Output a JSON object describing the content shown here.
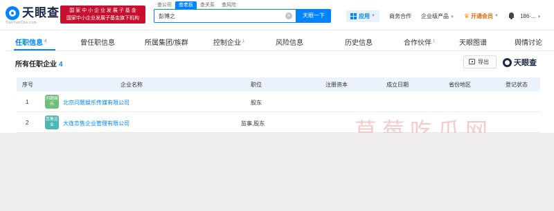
{
  "header": {
    "logo_text": "天眼查",
    "logo_sub": "TianYanCha.com",
    "banner_line1": "国 家 中 小 企 业 发 展 子 基 金",
    "banner_line2": "国家中小企业发展子基金旗下机构",
    "search_tabs": [
      "查公司",
      "查老板",
      "查关系",
      "查风险"
    ],
    "search_value": "彭博之",
    "search_button": "天眼一下",
    "app_label": "应用",
    "business": "商务合作",
    "enterprise": "企业级产品",
    "vip": "开通会员",
    "user": "186·..."
  },
  "tabs": [
    {
      "label": "任职信息",
      "count": "4"
    },
    {
      "label": "曾任职信息",
      "count": ""
    },
    {
      "label": "所属集团/族群",
      "count": ""
    },
    {
      "label": "控制企业",
      "count": "1"
    },
    {
      "label": "风险信息",
      "count": ""
    },
    {
      "label": "历史信息",
      "count": ""
    },
    {
      "label": "合作伙伴",
      "count": "1"
    },
    {
      "label": "天眼图谱",
      "count": ""
    },
    {
      "label": "舆情讨论",
      "count": ""
    }
  ],
  "section": {
    "title": "所有任职企业",
    "count": "4",
    "export": "导出",
    "brand": "天眼查"
  },
  "table": {
    "headers": [
      "序号",
      "企业名称",
      "职位",
      "注册资本",
      "成立日期",
      "省份地区",
      "登记状态"
    ],
    "rows": [
      {
        "index": "1",
        "logo": "问题娱乐",
        "logo_color": "#6fbf7a",
        "name": "北京问题娱乐传媒有限公司",
        "position": "股东"
      },
      {
        "index": "2",
        "logo": "恋售企业",
        "logo_color": "#4cb8b0",
        "name": "大连恋售企业管理有限公司",
        "position": "监事,股东"
      }
    ]
  },
  "watermark": "草莓吃瓜网"
}
